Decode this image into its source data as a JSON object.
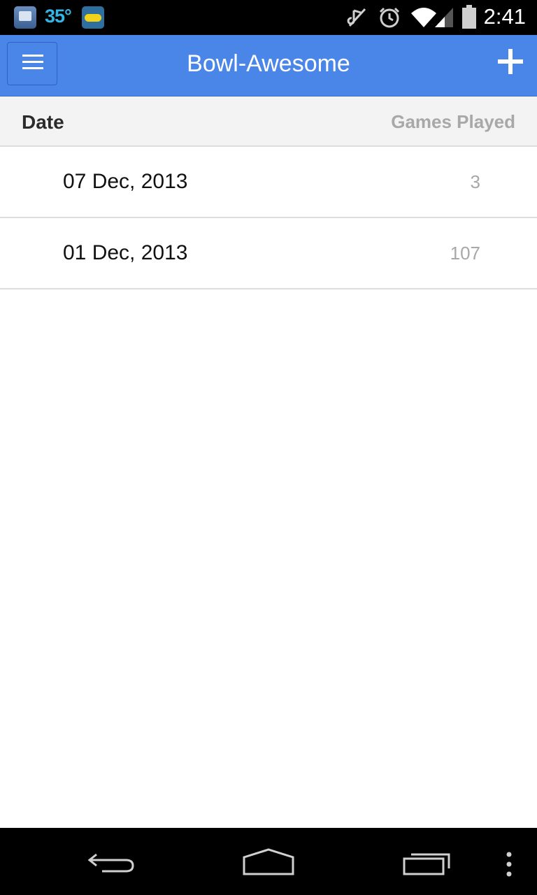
{
  "status_bar": {
    "temperature": "35°",
    "time": "2:41",
    "icons": [
      "weather-app-icon",
      "imo-app-icon",
      "mute-icon",
      "alarm-icon",
      "wifi-icon",
      "cell-signal-icon",
      "battery-icon"
    ]
  },
  "action_bar": {
    "title": "Bowl-Awesome",
    "color": "#4a86e8",
    "icons": [
      "menu-icon",
      "add-icon"
    ]
  },
  "list_header": {
    "date_label": "Date",
    "games_label": "Games Played"
  },
  "sessions": [
    {
      "date": "07 Dec, 2013",
      "games": "3"
    },
    {
      "date": "01 Dec, 2013",
      "games": "107"
    }
  ],
  "nav_bar": {
    "icons": [
      "back-icon",
      "home-icon",
      "recents-icon",
      "overflow-menu-icon"
    ]
  }
}
